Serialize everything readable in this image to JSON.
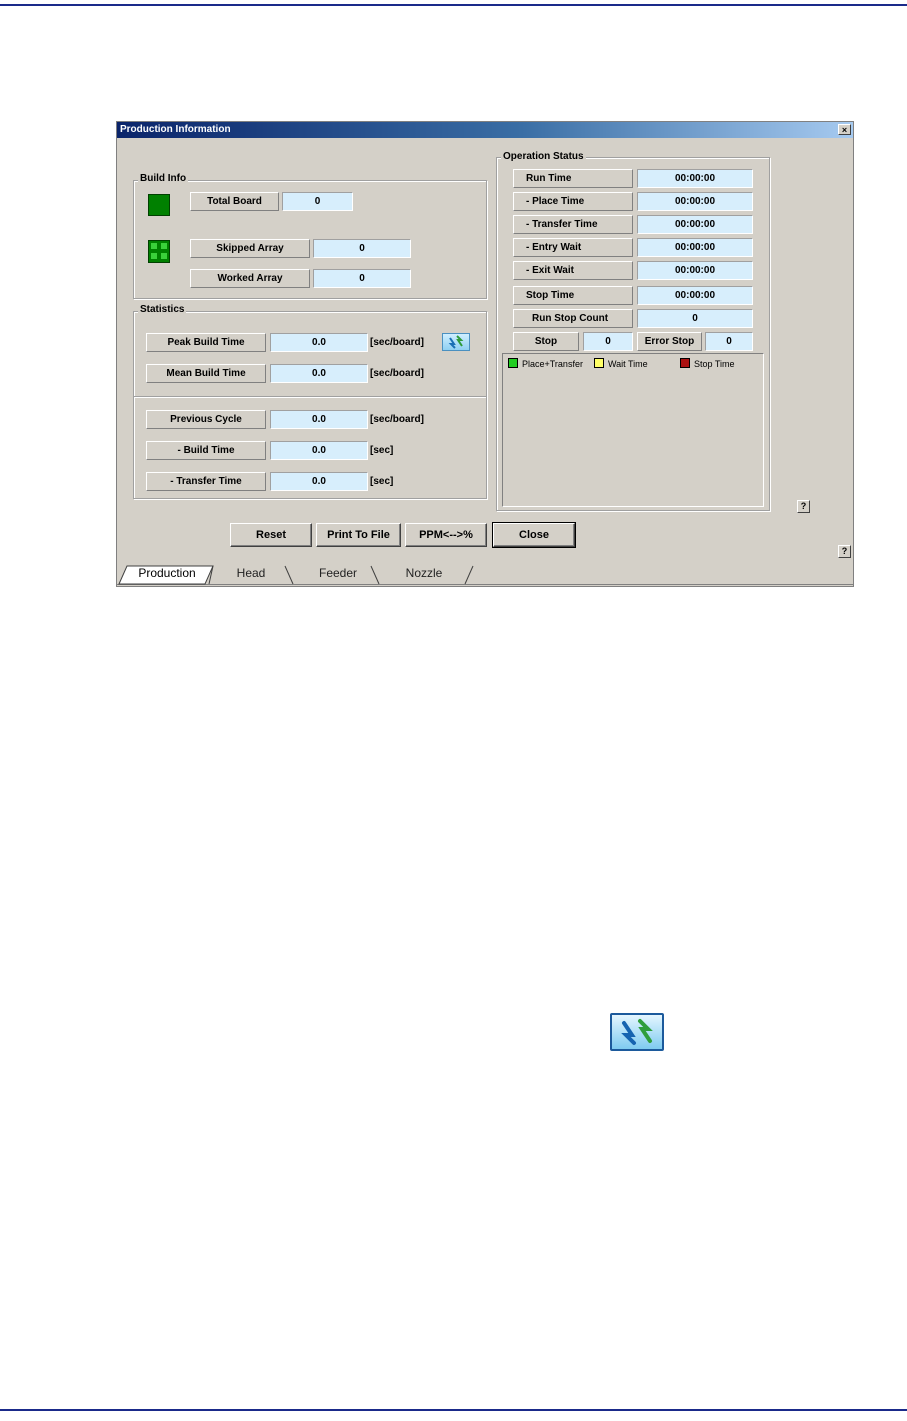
{
  "window": {
    "title": "Production Information",
    "close_glyph": "×"
  },
  "build_info": {
    "group_label": "Build Info",
    "total_board_label": "Total Board",
    "total_board_value": "0",
    "skipped_array_label": "Skipped Array",
    "skipped_array_value": "0",
    "worked_array_label": "Worked Array",
    "worked_array_value": "0"
  },
  "statistics": {
    "group_label": "Statistics",
    "peak_build_time_label": "Peak Build Time",
    "peak_build_time_value": "0.0",
    "peak_build_time_unit": "[sec/board]",
    "mean_build_time_label": "Mean Build Time",
    "mean_build_time_value": "0.0",
    "mean_build_time_unit": "[sec/board]",
    "previous_cycle_label": "Previous Cycle",
    "previous_cycle_value": "0.0",
    "previous_cycle_unit": "[sec/board]",
    "build_time_label": "- Build Time",
    "build_time_value": "0.0",
    "build_time_unit": "[sec]",
    "transfer_time_label": "- Transfer Time",
    "transfer_time_value": "0.0",
    "transfer_time_unit": "[sec]"
  },
  "operation_status": {
    "group_label": "Operation Status",
    "run_time_label": "Run Time",
    "run_time_value": "00:00:00",
    "place_time_label": "- Place Time",
    "place_time_value": "00:00:00",
    "transfer_time_label": "- Transfer Time",
    "transfer_time_value": "00:00:00",
    "entry_wait_label": "- Entry Wait",
    "entry_wait_value": "00:00:00",
    "exit_wait_label": "- Exit Wait",
    "exit_wait_value": "00:00:00",
    "stop_time_label": "Stop Time",
    "stop_time_value": "00:00:00",
    "run_stop_count_label": "Run Stop Count",
    "run_stop_count_value": "0",
    "stop_label": "Stop",
    "stop_value": "0",
    "error_stop_label": "Error Stop",
    "error_stop_value": "0",
    "legend": [
      {
        "label": "Place+Transfer",
        "color": "#22cc22"
      },
      {
        "label": "Wait Time",
        "color": "#ffff66"
      },
      {
        "label": "Stop Time",
        "color": "#aa1111"
      }
    ]
  },
  "buttons": {
    "reset": "Reset",
    "print_to_file": "Print To File",
    "ppm": "PPM<-->%",
    "close": "Close"
  },
  "help_glyph": "?",
  "tabs": [
    "Production",
    "Head",
    "Feeder",
    "Nozzle"
  ],
  "colors": {
    "title_bar": "#0a246a",
    "value_field": "#d7eefc",
    "board_icon": "#008000"
  },
  "icons": [
    "refresh-icon",
    "board-icon",
    "array-icon"
  ]
}
